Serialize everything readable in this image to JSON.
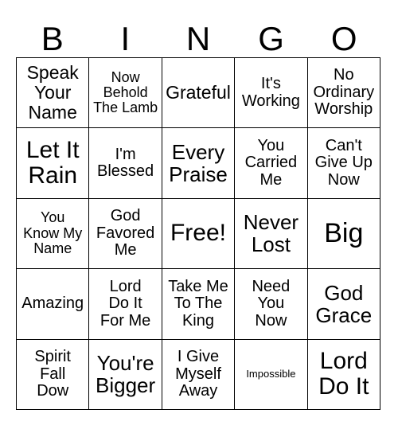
{
  "card": {
    "title": "BINGO",
    "header_letters": [
      "B",
      "I",
      "N",
      "G",
      "O"
    ],
    "grid_size": "5x5",
    "colors": {
      "background": "#ffffff",
      "text": "#000000",
      "border": "#000000"
    },
    "cells": [
      {
        "text": "Speak\nYour\nName",
        "size": "fs-xl",
        "row": 1,
        "col": "B"
      },
      {
        "text": "Now\nBehold\nThe Lamb",
        "size": "fs-md",
        "row": 1,
        "col": "I"
      },
      {
        "text": "Grateful",
        "size": "fs-xl",
        "row": 1,
        "col": "N"
      },
      {
        "text": "It's\nWorking",
        "size": "fs-lg",
        "row": 1,
        "col": "G"
      },
      {
        "text": "No\nOrdinary\nWorship",
        "size": "fs-lg",
        "row": 1,
        "col": "O"
      },
      {
        "text": "Let It\nRain",
        "size": "fs-3xl",
        "row": 2,
        "col": "B"
      },
      {
        "text": "I'm\nBlessed",
        "size": "fs-lg",
        "row": 2,
        "col": "I"
      },
      {
        "text": "Every\nPraise",
        "size": "fs-2xl",
        "row": 2,
        "col": "N"
      },
      {
        "text": "You\nCarried\nMe",
        "size": "fs-lg",
        "row": 2,
        "col": "G"
      },
      {
        "text": "Can't\nGive Up\nNow",
        "size": "fs-lg",
        "row": 2,
        "col": "O"
      },
      {
        "text": "You\nKnow My\nName",
        "size": "fs-md",
        "row": 3,
        "col": "B"
      },
      {
        "text": "God\nFavored\nMe",
        "size": "fs-lg",
        "row": 3,
        "col": "I"
      },
      {
        "text": "Free!",
        "size": "fs-3xl",
        "row": 3,
        "col": "N"
      },
      {
        "text": "Never\nLost",
        "size": "fs-2xl",
        "row": 3,
        "col": "G"
      },
      {
        "text": "Big",
        "size": "fs-4xl",
        "row": 3,
        "col": "O"
      },
      {
        "text": "Amazing",
        "size": "fs-lg",
        "row": 4,
        "col": "B"
      },
      {
        "text": "Lord\nDo It\nFor Me",
        "size": "fs-lg",
        "row": 4,
        "col": "I"
      },
      {
        "text": "Take Me\nTo The\nKing",
        "size": "fs-lg",
        "row": 4,
        "col": "N"
      },
      {
        "text": "Need\nYou\nNow",
        "size": "fs-lg",
        "row": 4,
        "col": "G"
      },
      {
        "text": "God\nGrace",
        "size": "fs-2xl",
        "row": 4,
        "col": "O"
      },
      {
        "text": "Spirit\nFall\nDow",
        "size": "fs-lg",
        "row": 5,
        "col": "B"
      },
      {
        "text": "You're\nBigger",
        "size": "fs-2xl",
        "row": 5,
        "col": "I"
      },
      {
        "text": "I Give\nMyself\nAway",
        "size": "fs-lg",
        "row": 5,
        "col": "N"
      },
      {
        "text": "Impossible",
        "size": "fs-xs",
        "row": 5,
        "col": "G"
      },
      {
        "text": "Lord\nDo It",
        "size": "fs-3xl",
        "row": 5,
        "col": "O"
      }
    ]
  }
}
